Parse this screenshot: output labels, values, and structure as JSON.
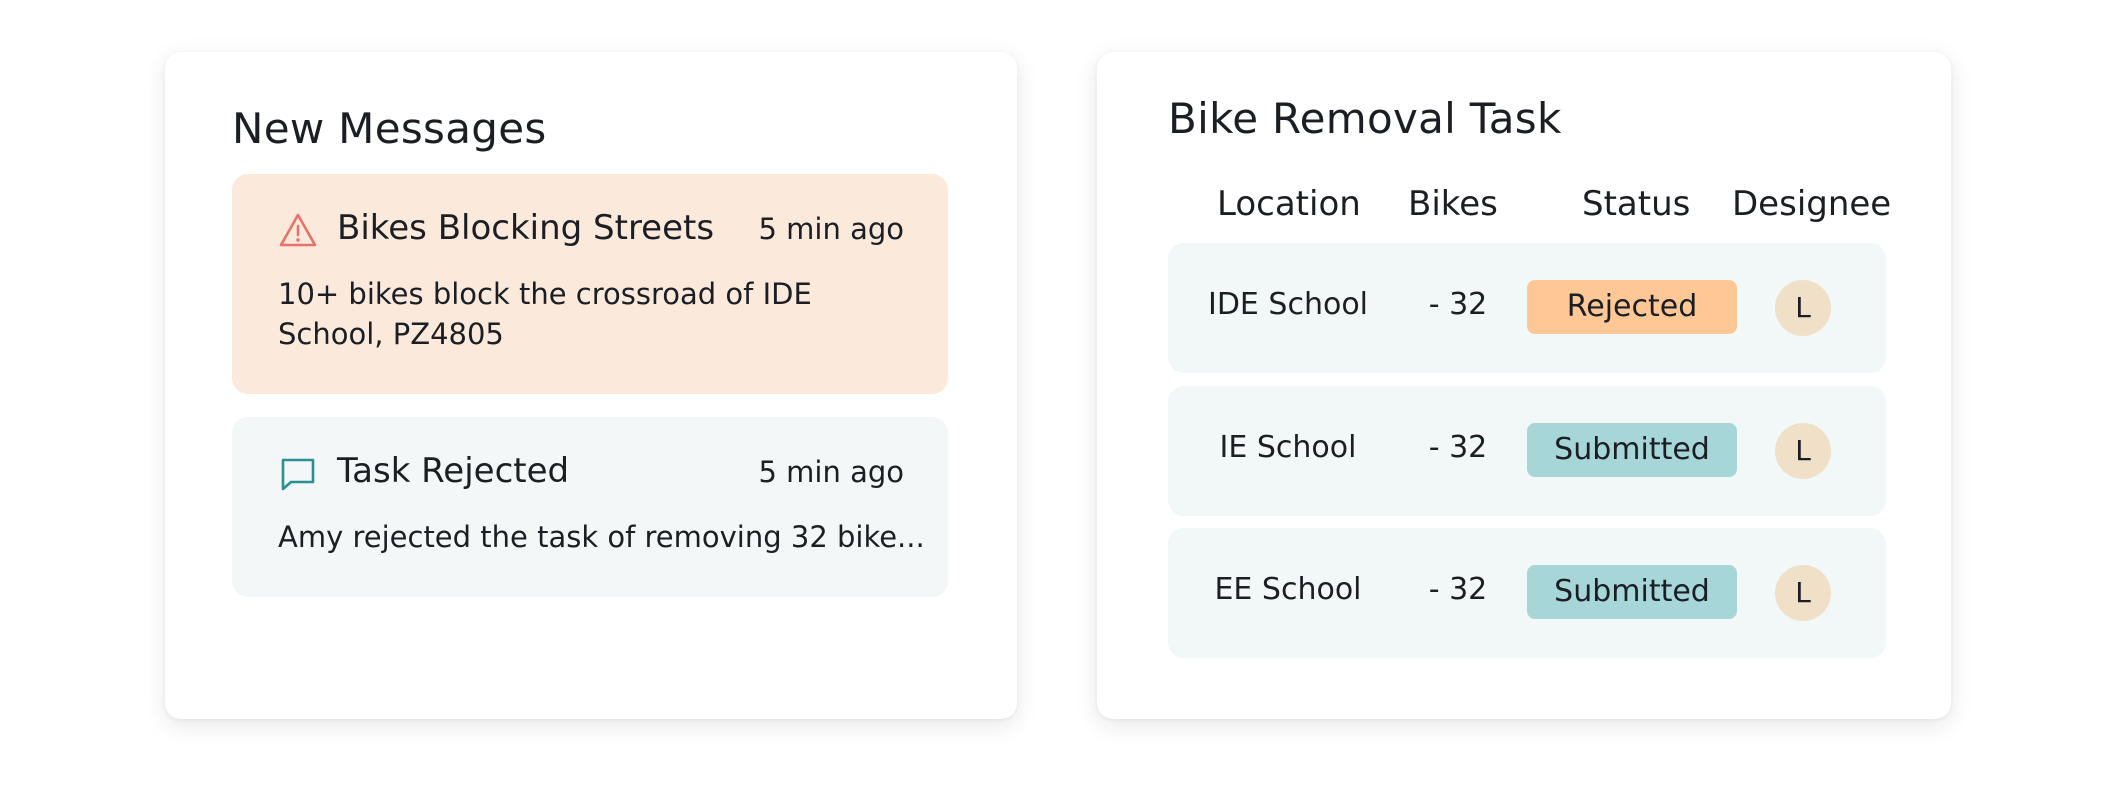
{
  "messages": {
    "title": "New Messages",
    "items": [
      {
        "icon": "warning-icon",
        "title": "Bikes Blocking Streets",
        "time": "5 min ago",
        "body": "10+ bikes block the crossroad of IDE School, PZ4805",
        "color": "#fbe9dc"
      },
      {
        "icon": "chat-icon",
        "title": "Task Rejected",
        "time": "5 min ago",
        "body": "Amy rejected the task of removing 32 bike...",
        "color": "#f3f7f7"
      }
    ]
  },
  "task": {
    "title": "Bike Removal Task",
    "columns": {
      "location": "Location",
      "bikes": "Bikes",
      "status": "Status",
      "designee": "Designee"
    },
    "rows": [
      {
        "location": "IDE School",
        "bikes": "- 32",
        "status": "Rejected",
        "designee": "L"
      },
      {
        "location": "IE School",
        "bikes": "- 32",
        "status": "Submitted",
        "designee": "L"
      },
      {
        "location": "EE School",
        "bikes": "- 32",
        "status": "Submitted",
        "designee": "L"
      }
    ]
  },
  "colors": {
    "rejected": "#fdc796",
    "submitted": "#a6d6d8",
    "warning_icon": "#e8716a",
    "chat_icon": "#2a9093",
    "avatar": "#f0e0c8"
  }
}
